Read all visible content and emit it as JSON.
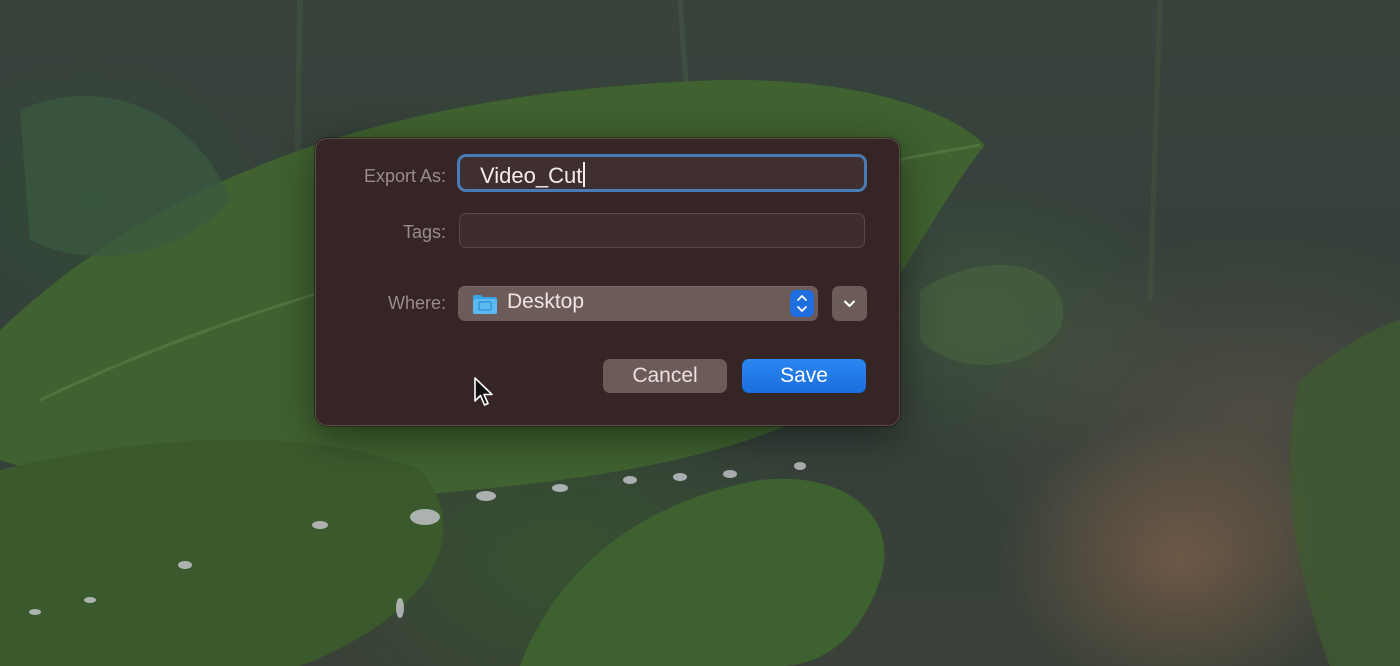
{
  "dialog": {
    "export_as_label": "Export As:",
    "export_as_value": "Video_Cut",
    "tags_label": "Tags:",
    "tags_value": "",
    "where_label": "Where:",
    "where_value": "Desktop",
    "cancel_label": "Cancel",
    "save_label": "Save"
  },
  "icons": {
    "folder": "folder-icon",
    "stepper": "popup-stepper-icon",
    "expand": "chevron-down-icon",
    "cursor": "mouse-pointer-icon"
  },
  "colors": {
    "dialog_background": "#352524",
    "focus_ring": "#4a7bb6",
    "accent": "#1e6fdd"
  }
}
